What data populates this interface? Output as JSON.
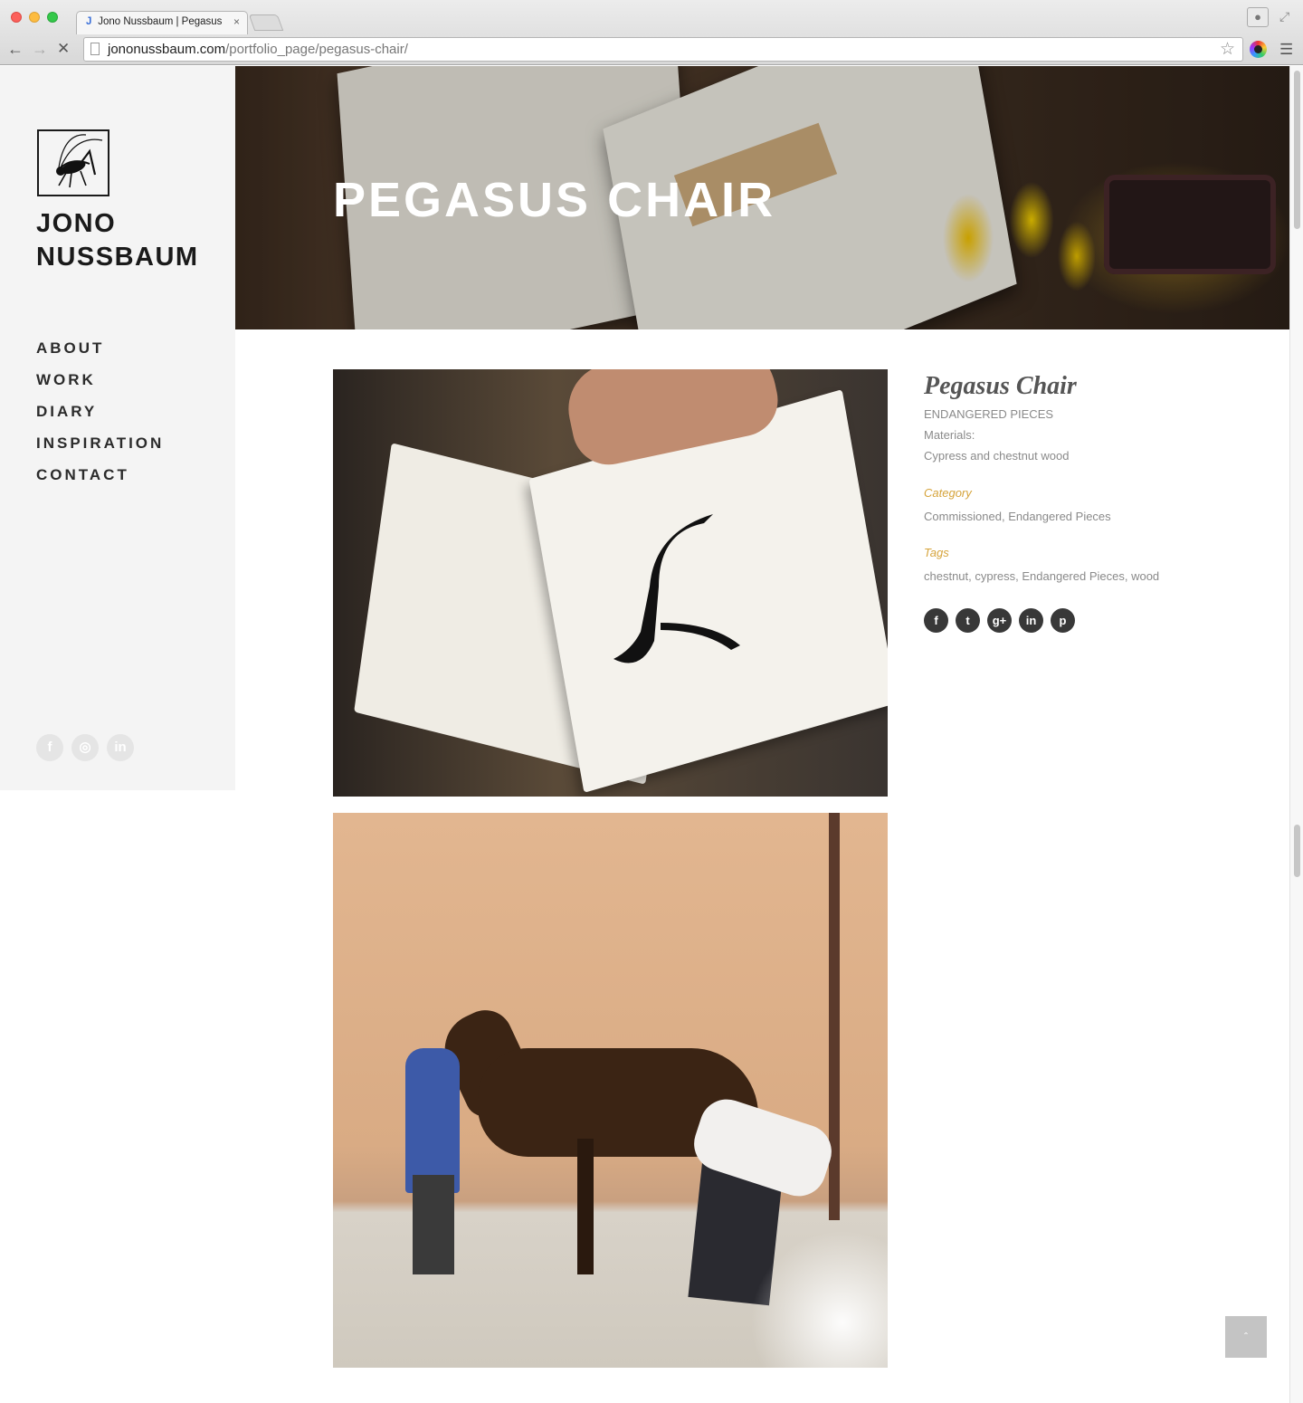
{
  "browser": {
    "tab_title": "Jono Nussbaum | Pegasus",
    "tab_close": "×",
    "url_domain": "jononussbaum.com",
    "url_path": "/portfolio_page/pegasus-chair/",
    "icons": [
      "back-arrow-icon",
      "forward-arrow-icon",
      "stop-icon",
      "page-icon",
      "star-icon",
      "extension-icon",
      "menu-icon",
      "profile-icon",
      "fullscreen-icon"
    ]
  },
  "sidebar": {
    "logo_line1": "JONO",
    "logo_line2": "NUSSBAUM",
    "nav": [
      "ABOUT",
      "WORK",
      "DIARY",
      "INSPIRATION",
      "CONTACT"
    ],
    "social_icons": [
      "facebook-icon",
      "instagram-icon",
      "linkedin-icon"
    ],
    "social_labels": [
      "f",
      "◎",
      "in"
    ]
  },
  "hero": {
    "title": "PEGASUS CHAIR"
  },
  "project": {
    "title": "Pegasus Chair",
    "collection": "ENDANGERED PIECES",
    "materials_label": "Materials:",
    "materials": "Cypress and chestnut wood",
    "category_label": "Category",
    "category": "Commissioned, Endangered Pieces",
    "tags_label": "Tags",
    "tags": "chestnut, cypress, Endangered Pieces, wood",
    "share_icons": [
      "facebook-icon",
      "twitter-icon",
      "google-plus-icon",
      "linkedin-icon",
      "pinterest-icon"
    ],
    "share_labels": [
      "f",
      "t",
      "g+",
      "in",
      "p"
    ]
  },
  "back_to_top": "ˆ"
}
